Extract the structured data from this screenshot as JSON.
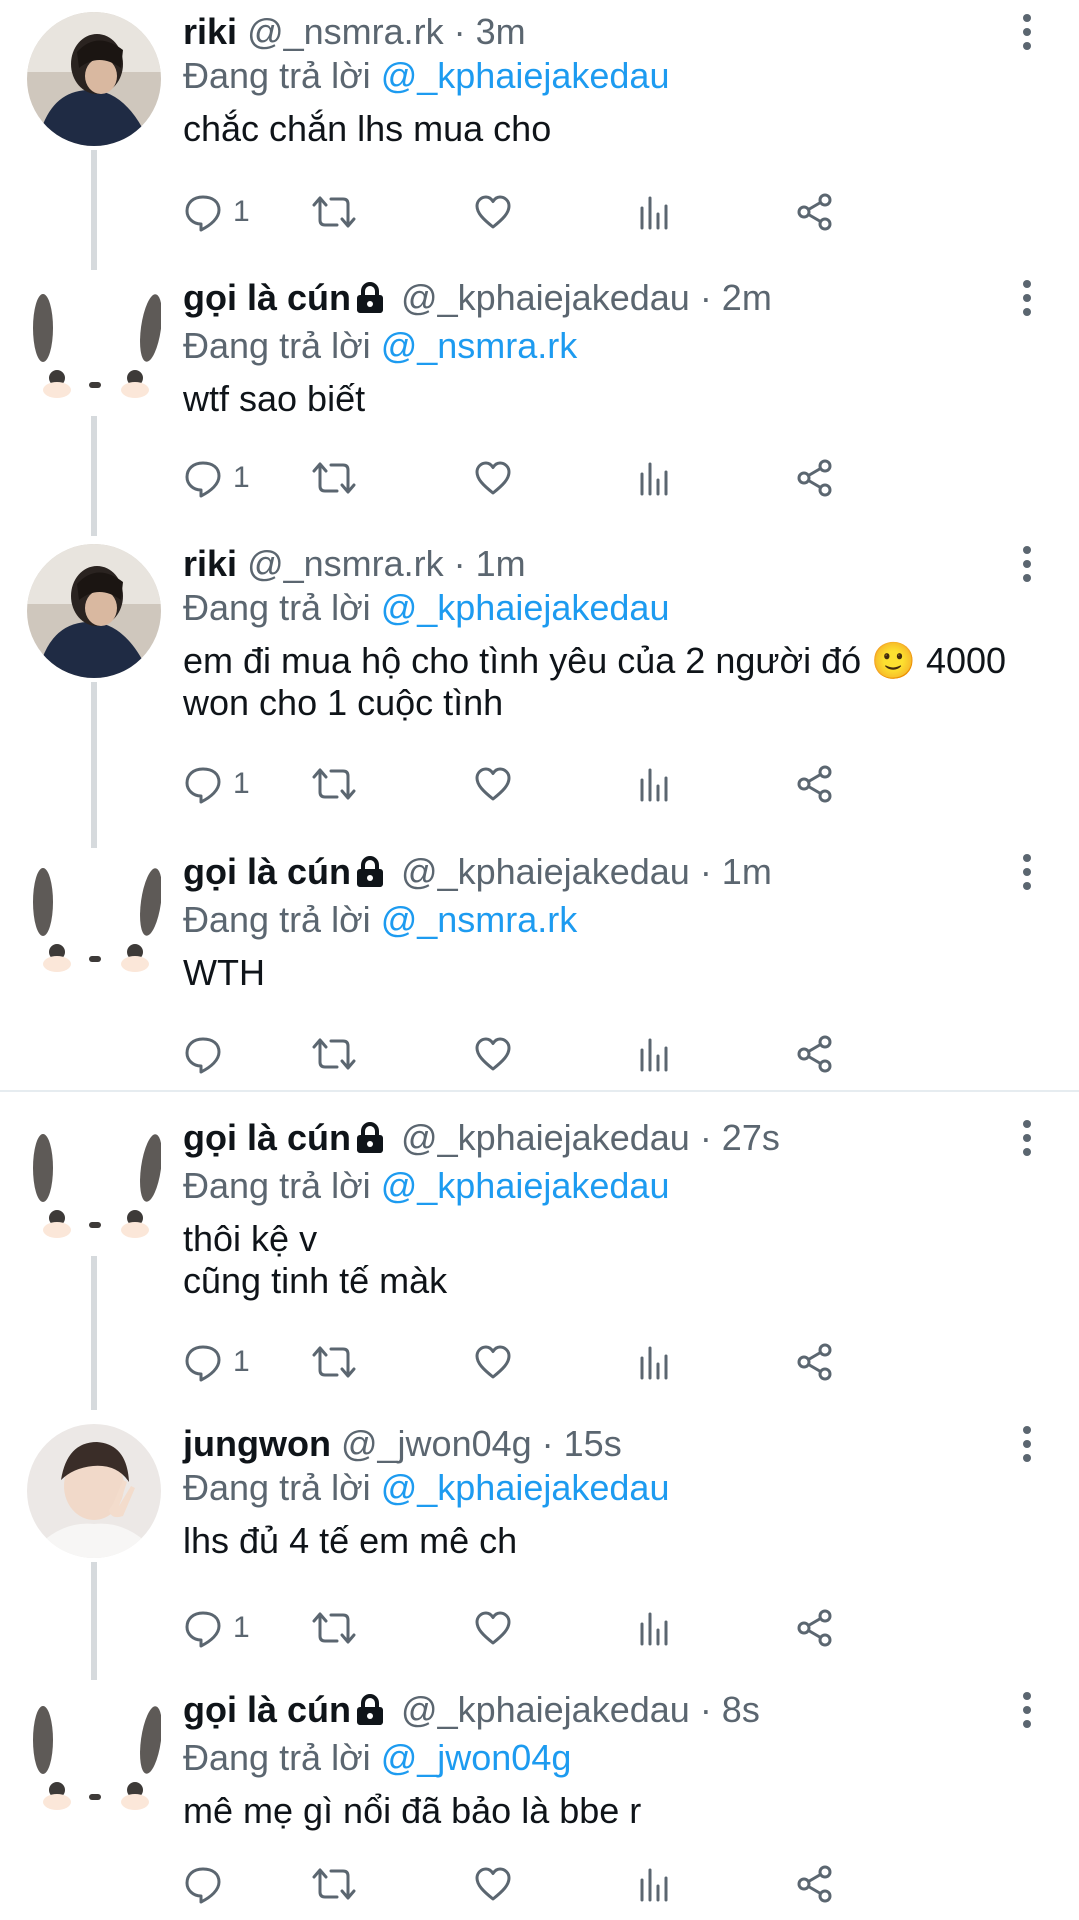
{
  "replying_label": "Đang trả lời",
  "tweets": [
    {
      "name": "riki",
      "handle": "@_nsmra.rk",
      "time": "· 3m",
      "reply_to": "@_kphaiejakedau",
      "text": "chắc chắn lhs mua cho",
      "reply_count": "1"
    },
    {
      "name": "gọi là cún",
      "handle": "@_kphaiejakedau",
      "time": "· 2m",
      "reply_to": "@_nsmra.rk",
      "text": "wtf sao biết",
      "reply_count": "1"
    },
    {
      "name": "riki",
      "handle": "@_nsmra.rk",
      "time": "· 1m",
      "reply_to": "@_kphaiejakedau",
      "text": "em đi mua hộ cho tình yêu của 2 người đó 🙂 4000\nwon cho 1 cuộc tình",
      "reply_count": "1"
    },
    {
      "name": "gọi là cún",
      "handle": "@_kphaiejakedau",
      "time": "· 1m",
      "reply_to": "@_nsmra.rk",
      "text": "WTH",
      "reply_count": ""
    },
    {
      "name": "gọi là cún",
      "handle": "@_kphaiejakedau",
      "time": "· 27s",
      "reply_to": "@_kphaiejakedau",
      "text": "thôi kệ v\ncũng tinh tế màk",
      "reply_count": "1"
    },
    {
      "name": "jungwon",
      "handle": "@_jwon04g",
      "time": "· 15s",
      "reply_to": "@_kphaiejakedau",
      "text": "lhs đủ 4 tế em mê ch",
      "reply_count": "1"
    },
    {
      "name": "gọi là cún",
      "handle": "@_kphaiejakedau",
      "time": "· 8s",
      "reply_to": "@_jwon04g",
      "text": "mê mẹ gì nổi đã bảo là bbe r",
      "reply_count": ""
    }
  ],
  "colors": {
    "mention": "#1d9bf0",
    "muted": "#5b6670",
    "text": "#0f1419",
    "thread_line": "#d6dadd"
  }
}
